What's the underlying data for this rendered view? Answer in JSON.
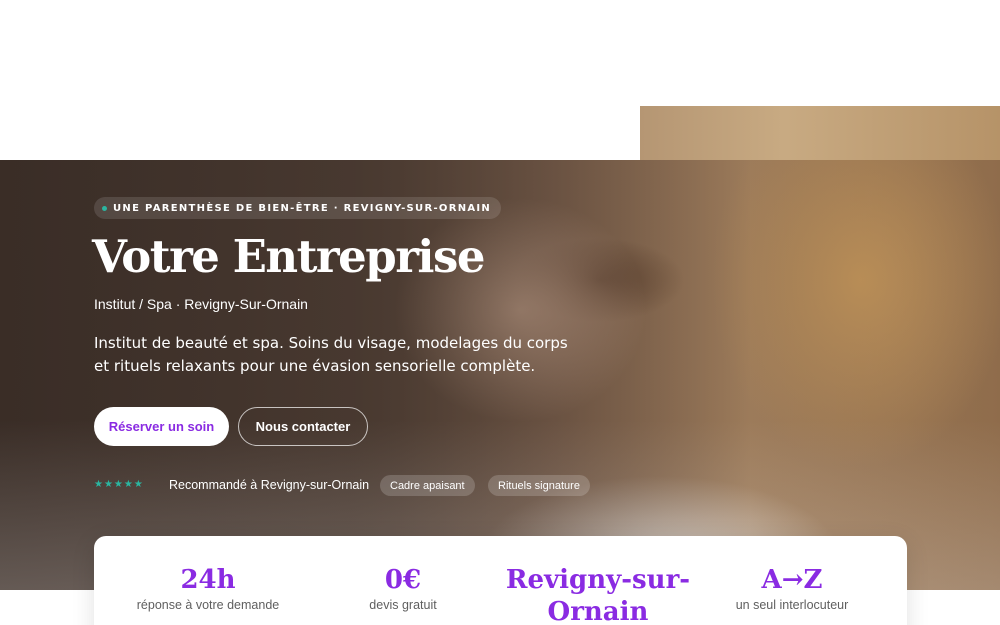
{
  "hero": {
    "eyebrow": "UNE PARENTHÈSE DE BIEN-ÊTRE · REVIGNY-SUR-ORNAIN",
    "title": "Votre Entreprise",
    "subtitle": "Institut / Spa · Revigny-Sur-Ornain",
    "description": "Institut de beauté et spa. Soins du visage, modelages du corps et rituels relaxants pour une évasion sensorielle complète.",
    "primary_button": "Réserver un soin",
    "secondary_button": "Nous contacter",
    "stars": "★★★★★",
    "recommendation": "Recommandé à Revigny-sur-Ornain",
    "chips": [
      "Cadre apaisant",
      "Rituels signature"
    ]
  },
  "stats": [
    {
      "value": "24h",
      "label": "réponse à votre demande"
    },
    {
      "value": "0€",
      "label": "devis gratuit"
    },
    {
      "value": "Revigny-sur-Ornain",
      "label": ""
    },
    {
      "value": "A→Z",
      "label": "un seul interlocuteur"
    }
  ],
  "colors": {
    "accent": "#8a2be2",
    "teal": "#2bb5a0",
    "text_light": "#ffffff",
    "muted": "#5f5f5f"
  }
}
